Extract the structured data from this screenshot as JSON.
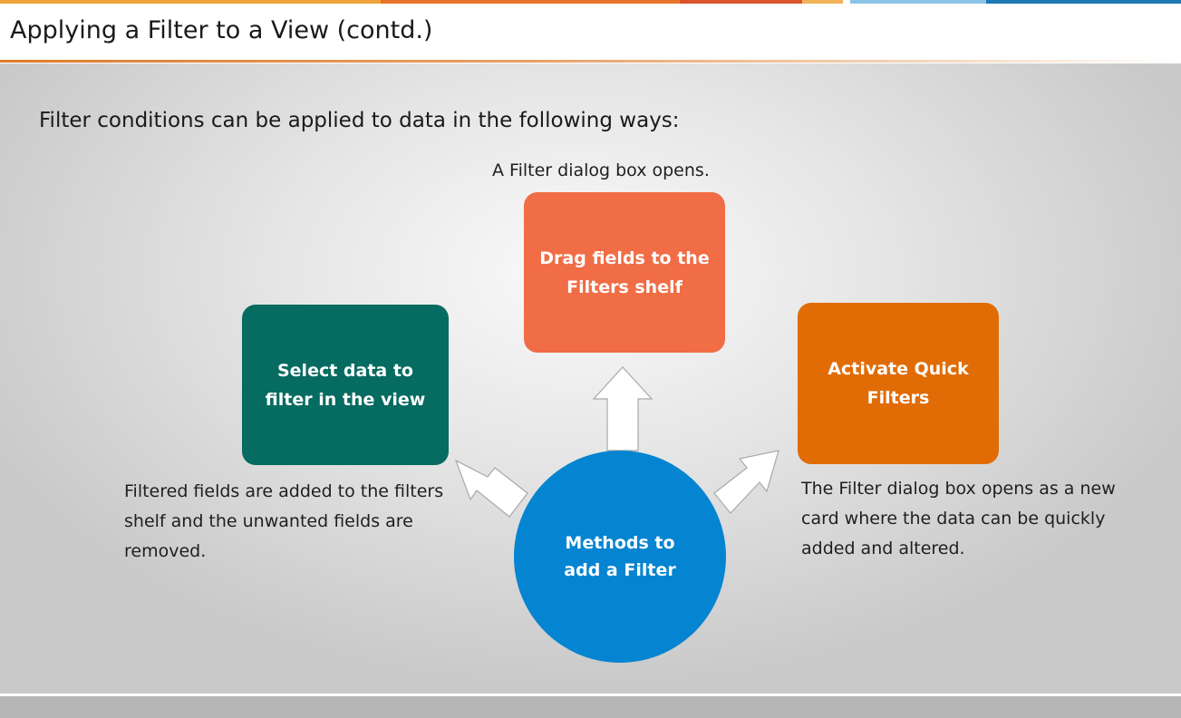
{
  "slide": {
    "title": "Applying a Filter to a View (contd.)",
    "intro": "Filter conditions can be applied to data in the following ways:"
  },
  "diagram": {
    "center": {
      "line1": "Methods to",
      "line2": "add a Filter",
      "color": "#0584d1"
    },
    "boxes": [
      {
        "id": "left",
        "line1": "Select data to",
        "line2": "filter in the view",
        "color": "#066b60",
        "caption": "Filtered fields are added to the filters shelf and the unwanted fields are removed."
      },
      {
        "id": "top",
        "line1": "Drag fields to the",
        "line2": "Filters shelf",
        "color": "#f06d45",
        "caption": "A Filter dialog box opens."
      },
      {
        "id": "right",
        "line1": "Activate Quick",
        "line2": "Filters",
        "color": "#e16c05",
        "caption": "The Filter dialog box opens as a new card where the data can be quickly added and altered."
      }
    ]
  },
  "theme": {
    "accent": "#e07b2a",
    "stripe": [
      "#f0a23a",
      "#e8742b",
      "#d9542c",
      "#f2b25a",
      "#8bc4e6",
      "#1f78b4"
    ]
  }
}
